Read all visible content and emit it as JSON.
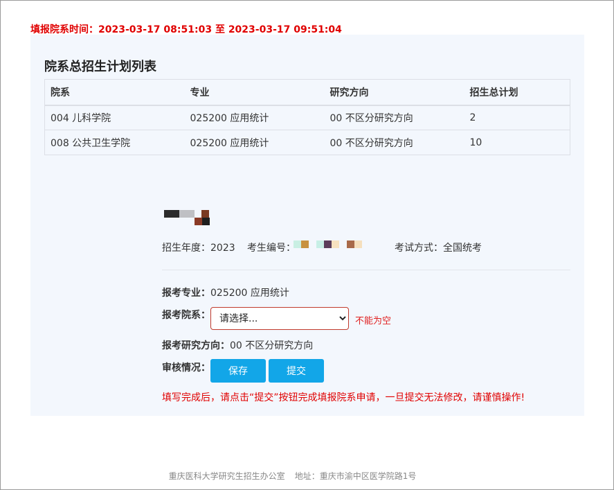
{
  "header": {
    "time_label": "填报院系时间：",
    "time_range": "2023-03-17 08:51:03 至 2023-03-17 09:51:04"
  },
  "plan_table": {
    "title": "院系总招生计划列表",
    "columns": [
      "院系",
      "专业",
      "研究方向",
      "招生总计划"
    ],
    "rows": [
      [
        "004 儿科学院",
        "025200 应用统计",
        "00 不区分研究方向",
        "2"
      ],
      [
        "008 公共卫生学院",
        "025200 应用统计",
        "00 不区分研究方向",
        "10"
      ]
    ]
  },
  "candidate": {
    "year_label": "招生年度：",
    "year": "2023",
    "id_label": "考生编号：",
    "exam_label": "考试方式：",
    "exam_type": "全国统考"
  },
  "form": {
    "major_label": "报考专业：",
    "major_value": "025200 应用统计",
    "dept_label": "报考院系：",
    "dept_selected": "请选择...",
    "dept_error": "不能为空",
    "direction_label": "报考研究方向：",
    "direction_value": "00 不区分研究方向",
    "review_label": "审核情况：",
    "save_label": "保存",
    "submit_label": "提交",
    "warning": "填写完成后，请点击“提交”按钮完成填报院系申请，一旦提交无法修改，请谨慎操作!"
  },
  "footer": {
    "office": "重庆医科大学研究生招生办公室",
    "address": "地址：重庆市渝中区医学院路1号"
  },
  "colors": {
    "accent": "#12a6e8",
    "error": "#e00000",
    "panel_bg": "#f3f7fd"
  }
}
